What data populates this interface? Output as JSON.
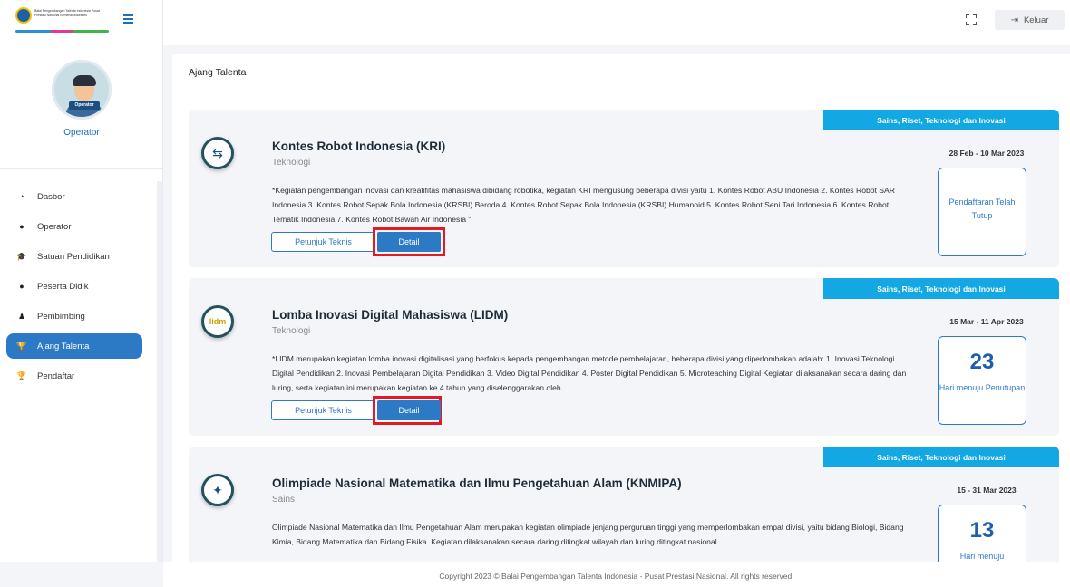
{
  "brand": {
    "text": "Balai Pengembangan Talenta Indonesia Pusat Prestasi Nasional Kemendikbudristek"
  },
  "user": {
    "name": "Operator",
    "badge": "Operator"
  },
  "nav": [
    {
      "label": "Dasbor",
      "icon": "dashboard-icon",
      "glyph": "◔"
    },
    {
      "label": "Operator",
      "icon": "user-icon",
      "glyph": "●"
    },
    {
      "label": "Satuan Pendidikan",
      "icon": "graduation-cap-icon",
      "glyph": "🎓"
    },
    {
      "label": "Peserta Didik",
      "icon": "user-icon",
      "glyph": "●"
    },
    {
      "label": "Pembimbing",
      "icon": "users-icon",
      "glyph": "♟"
    },
    {
      "label": "Ajang Talenta",
      "icon": "trophy-icon",
      "glyph": "🏆"
    },
    {
      "label": "Pendaftar",
      "icon": "trophy-icon",
      "glyph": "🏆"
    }
  ],
  "topbar": {
    "logout_label": "Keluar"
  },
  "main": {
    "title": "Ajang Talenta"
  },
  "cards": [
    {
      "category_badge": "Sains, Riset, Teknologi dan Inovasi",
      "title": "Kontes Robot Indonesia (KRI)",
      "category": "Teknologi",
      "description": "*Kegiatan pengembangan inovasi dan kreatifitas mahasiswa dibidang robotika, kegiatan KRI mengusung beberapa divisi yaitu 1. Kontes Robot ABU Indonesia 2. Kontes Robot SAR Indonesia 3. Kontes Robot Sepak Bola Indonesia (KRSBI) Beroda 4. Kontes Robot Sepak Bola Indonesia (KRSBI) Humanoid 5. Kontes Robot Seni Tari Indonesia 6. Kontes Robot Tematik Indonesia 7. Kontes Robot Bawah Air Indonesia \"",
      "juknis_label": "Petunjuk Teknis",
      "detail_label": "Detail",
      "date": "28 Feb - 10 Mar 2023",
      "status_text": "Pendaftaran Telah Tutup",
      "logo_glyph": "⇆"
    },
    {
      "category_badge": "Sains, Riset, Teknologi dan Inovasi",
      "title": "Lomba Inovasi Digital Mahasiswa (LIDM)",
      "category": "Teknologi",
      "description": "*LIDM merupakan kegiatan lomba inovasi digitalisasi yang berfokus kepada pengembangan metode pembelajaran, beberapa divisi yang diperlombakan adalah: 1. Inovasi Teknologi Digital Pendidikan 2. Inovasi Pembelajaran Digital Pendidikan 3. Video Digital Pendidikan 4. Poster Digital Pendidikan 5. Microteaching Digital Kegiatan dilaksanakan secara daring dan luring, serta kegiatan ini merupakan kegiatan ke 4 tahun yang diselenggarakan oleh...",
      "juknis_label": "Petunjuk Teknis",
      "detail_label": "Detail",
      "date": "15 Mar - 11 Apr 2023",
      "days_count": "23",
      "days_label": "Hari menuju Penutupan",
      "logo_glyph": "lidm"
    },
    {
      "category_badge": "Sains, Riset, Teknologi dan Inovasi",
      "title": "Olimpiade Nasional Matematika dan Ilmu Pengetahuan Alam (KNMIPA)",
      "category": "Sains",
      "description": "Olimpiade Nasional Matematika dan Ilmu Pengetahuan Alam merupakan kegiatan olimpiade jenjang perguruan tinggi yang memperlombakan empat divisi, yaitu bidang Biologi, Bidang Kimia, Bidang Matematika dan Bidang Fisika. Kegiatan dilaksanakan secara daring ditingkat wilayah dan luring ditingkat nasional",
      "date": "15 - 31 Mar 2023",
      "days_count": "13",
      "days_label": "Hari menuju",
      "logo_glyph": "✦"
    }
  ],
  "footer": {
    "text": "Copyright 2023 © Balai Pengembangan Talenta Indonesia - Pusat Prestasi Nasional. All rights reserved."
  }
}
